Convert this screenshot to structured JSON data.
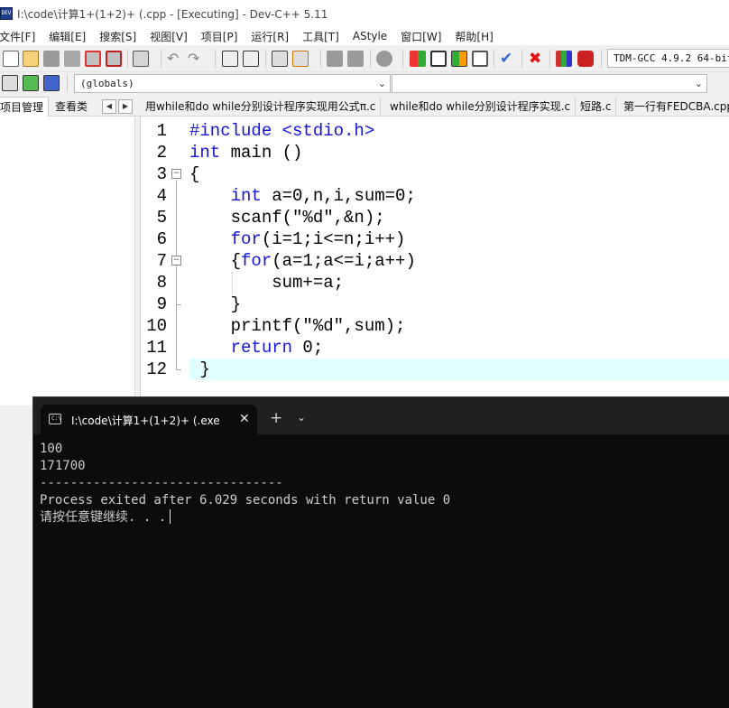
{
  "window": {
    "title": "I:\\code\\计算1+(1+2)+  (.cpp - [Executing] - Dev-C++ 5.11",
    "icon_label": "DEV"
  },
  "menu": [
    "文件[F]",
    "编辑[E]",
    "搜索[S]",
    "视图[V]",
    "项目[P]",
    "运行[R]",
    "工具[T]",
    "AStyle",
    "窗口[W]",
    "帮助[H]"
  ],
  "toolbar": {
    "compiler": "TDM-GCC 4.9.2 64-bit Release",
    "icons": [
      "new-file-icon",
      "open-file-icon",
      "save-icon",
      "save-all-icon",
      "close-file-icon",
      "close-all-icon",
      "print-icon",
      "undo-icon",
      "redo-icon",
      "find-icon",
      "replace-icon",
      "indent-icon",
      "unindent-icon",
      "bookmark-icon",
      "goto-icon",
      "toggle-comment-icon",
      "new-class-icon",
      "project-icon",
      "layout-icon",
      "grid-icon",
      "check-icon",
      "stop-icon",
      "chart-icon",
      "debug-icon"
    ]
  },
  "toolbar2": {
    "globals_value": "(globals)",
    "members_value": ""
  },
  "left_panel": {
    "tabs": [
      "项目管理",
      "查看类"
    ],
    "nav_prev": "◀",
    "nav_next": "▶"
  },
  "file_tabs": [
    "用while和do while分别设计程序实现用公式π.c",
    "while和do while分别设计程序实现.c",
    "短路.c",
    "第一行有FEDCBA.cpp"
  ],
  "editor": {
    "current_line": 12,
    "lines": [
      {
        "n": "1",
        "code": [
          {
            "t": "#include <stdio.h>",
            "k": true
          }
        ]
      },
      {
        "n": "2",
        "code": [
          {
            "t": "int",
            "k": true
          },
          {
            "t": " main ()",
            "k": false
          }
        ]
      },
      {
        "n": "3",
        "code": [
          {
            "t": "{",
            "k": false
          }
        ]
      },
      {
        "n": "4",
        "code": [
          {
            "t": "    ",
            "k": false
          },
          {
            "t": "int",
            "k": true
          },
          {
            "t": " a=0,n,i,sum=0;",
            "k": false
          }
        ]
      },
      {
        "n": "5",
        "code": [
          {
            "t": "    scanf(\"%d\",&n);",
            "k": false
          }
        ]
      },
      {
        "n": "6",
        "code": [
          {
            "t": "    ",
            "k": false
          },
          {
            "t": "for",
            "k": true
          },
          {
            "t": "(i=1;i<=n;i++)",
            "k": false
          }
        ]
      },
      {
        "n": "7",
        "code": [
          {
            "t": "    {",
            "k": false
          },
          {
            "t": "for",
            "k": true
          },
          {
            "t": "(a=1;a<=i;a++)",
            "k": false
          }
        ]
      },
      {
        "n": "8",
        "code": [
          {
            "t": "        sum+=a;",
            "k": false
          }
        ]
      },
      {
        "n": "9",
        "code": [
          {
            "t": "    }",
            "k": false
          }
        ]
      },
      {
        "n": "10",
        "code": [
          {
            "t": "    printf(\"%d\",sum);",
            "k": false
          }
        ]
      },
      {
        "n": "11",
        "code": [
          {
            "t": "    ",
            "k": false
          },
          {
            "t": "return",
            "k": true
          },
          {
            "t": " 0;",
            "k": false
          }
        ]
      },
      {
        "n": "12",
        "code": [
          {
            "t": " }",
            "k": false
          }
        ]
      }
    ]
  },
  "terminal": {
    "tab_title": "I:\\code\\计算1+(1+2)+  (.exe",
    "close": "✕",
    "new_tab": "+",
    "dropdown": "⌄",
    "lines": [
      "100",
      "171700",
      "--------------------------------",
      "Process exited after 6.029 seconds with return value 0",
      "请按任意键继续. . ."
    ]
  },
  "colors": {
    "keyword": "#1414dc",
    "current_line": "#e2ffff",
    "terminal_bg": "#0c0c0c"
  }
}
